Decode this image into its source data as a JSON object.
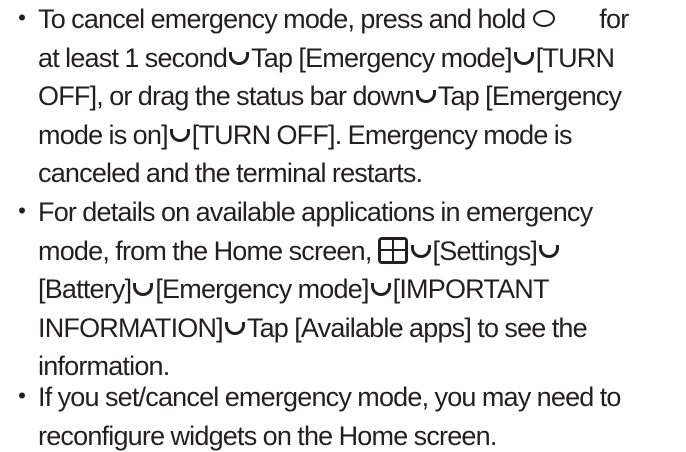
{
  "notes": [
    {
      "bullet": "・",
      "lines": [
        [
          "To cancel emergency mode, press and hold",
          "for"
        ],
        [
          "at least 1 second",
          "Tap [Emergency mode]",
          "[TURN"
        ],
        [
          "OFF], or drag the status bar down",
          "Tap [Emergency"
        ],
        [
          "mode is on]",
          "[TURN OFF]. Emergency mode is"
        ],
        [
          "canceled and the terminal restarts."
        ]
      ]
    },
    {
      "bullet": "・",
      "lines": [
        [
          "For details on available applications in emergency"
        ],
        [
          "mode, from the Home screen,",
          "[Settings]"
        ],
        [
          "[Battery]",
          "[Emergency mode]",
          "[IMPORTANT"
        ],
        [
          "INFORMATION]",
          "Tap [Available apps] to see the"
        ],
        [
          "information."
        ]
      ]
    },
    {
      "bullet": "・",
      "lines": [
        [
          "If you set/cancel emergency mode, you may need to"
        ],
        [
          "reconfigure widgets on the Home screen."
        ]
      ]
    }
  ],
  "icons": {
    "power_key": "circle-key-icon",
    "step_arrow": "u-arrow-icon",
    "apps_key": "apps-grid-icon"
  }
}
